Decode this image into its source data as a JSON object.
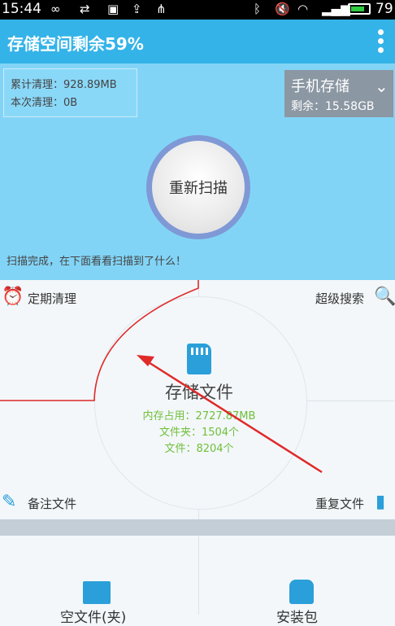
{
  "status_bar": {
    "time": "15:44",
    "battery_percent": "79",
    "icons": [
      "infinity-icon",
      "usb-icon",
      "image-icon",
      "upload-icon",
      "share-icon",
      "bluetooth-icon",
      "mute-icon",
      "wifi-icon",
      "signal-icon",
      "battery-icon"
    ]
  },
  "app_bar": {
    "title": "存储空间剩余59%"
  },
  "scan_panel": {
    "total_cleaned": "累计清理：928.89MB",
    "this_cleaned": "本次清理：0B",
    "storage_name": "手机存储",
    "storage_free": "剩余：15.58GB",
    "rescan_label": "重新扫描",
    "scan_message": "扫描完成，在下面看看扫描到了什么！"
  },
  "grid": {
    "top_left": "定期清理",
    "top_right": "超级搜索",
    "bottom_left": "备注文件",
    "bottom_right": "重复文件",
    "center_title": "存储文件",
    "center_memory": "内存占用：2727.87MB",
    "center_folders": "文件夹：1504个",
    "center_files": "文件：8204个",
    "next_left_label": "空文件(夹)",
    "next_right_label": "安装包"
  },
  "colors": {
    "accent": "#34b3e8",
    "panel": "#82d4f6",
    "info_green": "#6fbf3a",
    "annotation_red": "#e02a2a"
  }
}
